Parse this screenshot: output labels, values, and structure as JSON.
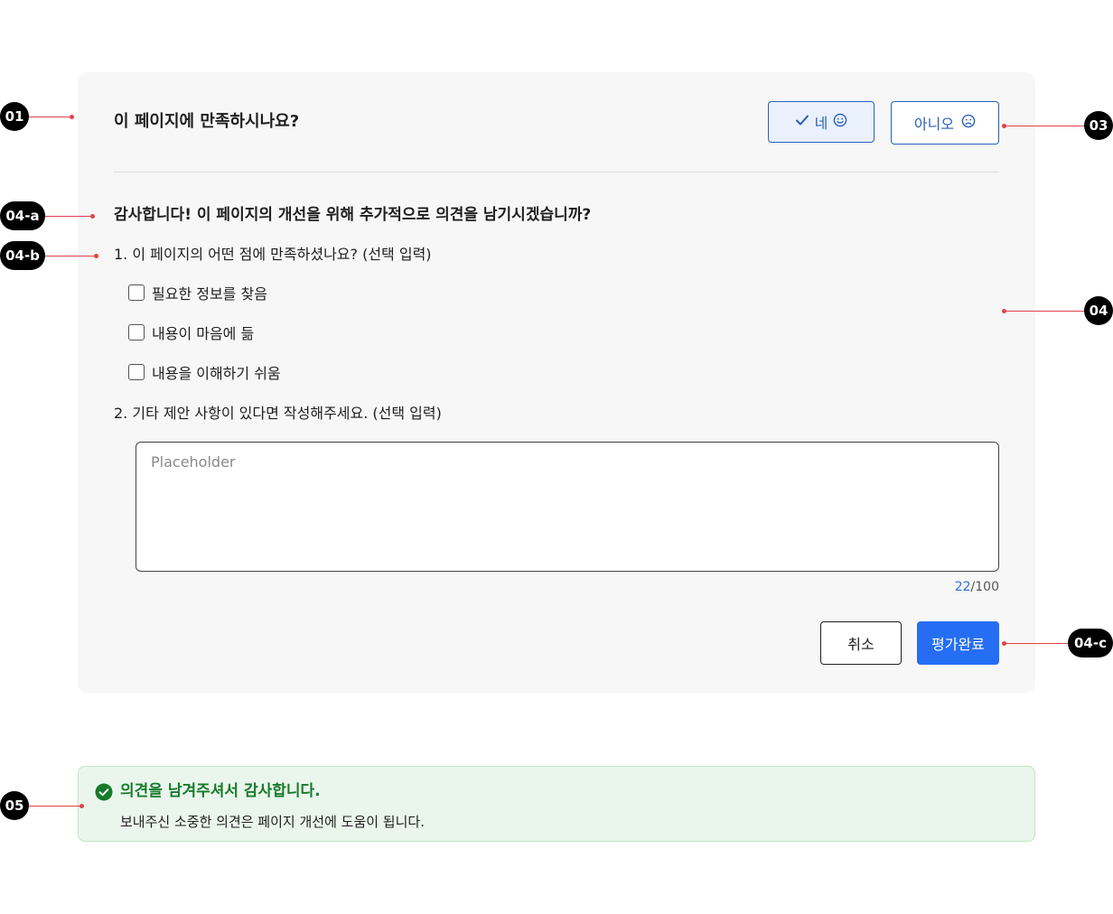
{
  "survey": {
    "question": "이 페이지에 만족하시나요?",
    "yes_label": "네",
    "no_label": "아니오",
    "followup_title": "감사합니다! 이 페이지의 개선을 위해 추가적으로 의견을 남기시겠습니까?",
    "q1_number": "1.",
    "q1_text": "이 페이지의 어떤 점에 만족하셨나요? (선택 입력)",
    "options": [
      {
        "label": "필요한 정보를 찾음",
        "checked": false
      },
      {
        "label": "내용이 마음에 듦",
        "checked": false
      },
      {
        "label": "내용을 이해하기 쉬움",
        "checked": false
      }
    ],
    "q2_number": "2.",
    "q2_text": "기타 제안 사항이 있다면 작성해주세요. (선택 입력)",
    "textarea_placeholder": "Placeholder",
    "char_count": "22",
    "char_max": "/100",
    "cancel_label": "취소",
    "submit_label": "평가완료"
  },
  "toast": {
    "title": "의견을 남겨주셔서 감사합니다.",
    "body": "보내주신 소중한 의견은 페이지 개선에 도움이 됩니다."
  },
  "markers": {
    "m01": "01",
    "m03": "03",
    "m04a": "04-a",
    "m04b": "04-b",
    "m04": "04",
    "m04c": "04-c",
    "m05": "05"
  },
  "colors": {
    "primary": "#256ef4",
    "success": "#177a2b",
    "marker_line": "#e0424a"
  },
  "icons": {
    "yes": [
      "check-icon",
      "smile-icon"
    ],
    "no": "frown-icon",
    "toast": "check-circle-icon"
  }
}
